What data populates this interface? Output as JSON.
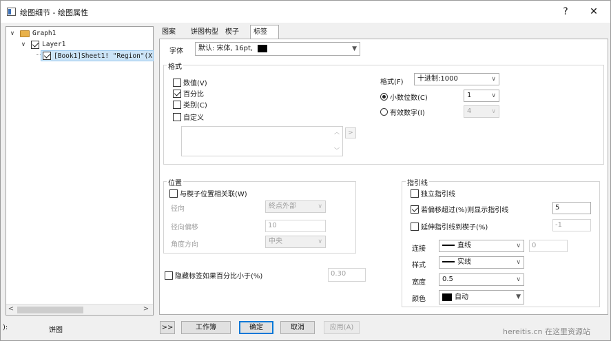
{
  "window": {
    "title": "绘图细节 - 绘图属性",
    "help_btn": "?",
    "close_btn": "✕"
  },
  "tree": {
    "items": [
      {
        "label": "Graph1"
      },
      {
        "label": "Layer1"
      },
      {
        "label": "[Book1]Sheet1! \"Region\"(X"
      }
    ],
    "left_arrow": "<",
    "right_arrow": ">"
  },
  "bottom_left": {
    "label1": "):",
    "label2": "饼图"
  },
  "tabs": [
    "图案",
    "饼图构型",
    "楔子",
    "标签"
  ],
  "font": {
    "label": "字体",
    "value": "默认: 宋体, 16pt,"
  },
  "format_group": {
    "title": "格式",
    "options": [
      {
        "label": "数值(V)",
        "checked": false
      },
      {
        "label": "百分比",
        "checked": true
      },
      {
        "label": "类别(C)",
        "checked": false
      },
      {
        "label": "自定义",
        "checked": false
      }
    ],
    "format_label": "格式(F)",
    "format_value": "十进制:1000",
    "decimal_label": "小数位数(C)",
    "decimal_value": "1",
    "sigdigits_label": "有效数字(I)",
    "sigdigits_value": "4",
    "up_arrow": "︿",
    "down_arrow": "﹀",
    "expand_btn": ">"
  },
  "position_group": {
    "title": "位置",
    "assoc_label": "与楔子位置相关联(W)",
    "radial_label": "径向",
    "radial_value": "終点外部",
    "offset_label": "径向偏移",
    "offset_value": "10",
    "angle_label": "角度方向",
    "angle_value": "中央"
  },
  "hide": {
    "label": "隐藏标签如果百分比小于(%)",
    "value": "0.30"
  },
  "leader_group": {
    "title": "指引线",
    "indep_label": "独立指引线",
    "show_label": "若偏移超过(%)则显示指引线",
    "show_value": "5",
    "extend_label": "延伸指引线到楔子(%)",
    "extend_value": "-1",
    "connect_label": "连接",
    "connect_value": "直线",
    "connect_extra": "0",
    "style_label": "样式",
    "style_value": "实线",
    "width_label": "宽度",
    "width_value": "0.5",
    "color_label": "颜色",
    "color_value": "自动"
  },
  "buttons": {
    "expand": ">>",
    "workbook": "工作簿",
    "ok": "确定",
    "cancel": "取消",
    "apply": "应用(A)"
  },
  "watermark": "hereitis.cn 在这里资源站",
  "colors": {
    "accent": "#0078d7",
    "selection": "#cce4f7"
  }
}
